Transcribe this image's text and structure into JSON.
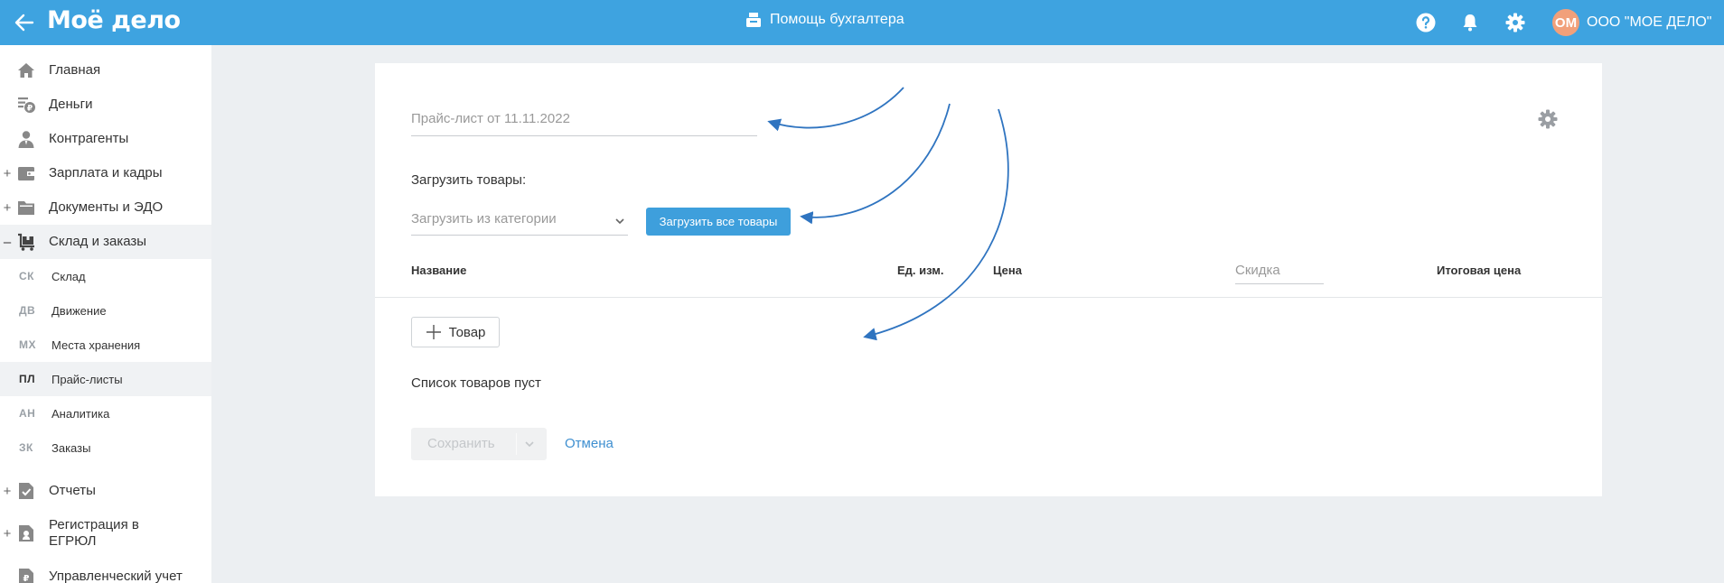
{
  "header": {
    "logo": "Моё дело",
    "help_center": "Помощь бухгалтера",
    "avatar_initials": "ОМ",
    "company": "ООО \"МОЕ ДЕЛО\""
  },
  "sidebar": {
    "items": [
      {
        "label": "Главная"
      },
      {
        "label": "Деньги"
      },
      {
        "label": "Контрагенты"
      },
      {
        "label": "Зарплата и кадры",
        "expander": "+"
      },
      {
        "label": "Документы и ЭДО",
        "expander": "+"
      },
      {
        "label": "Склад и заказы",
        "expander": "–"
      }
    ],
    "subitems": [
      {
        "abbr": "СК",
        "label": "Склад"
      },
      {
        "abbr": "ДВ",
        "label": "Движение"
      },
      {
        "abbr": "МХ",
        "label": "Места хранения"
      },
      {
        "abbr": "ПЛ",
        "label": "Прайс-листы"
      },
      {
        "abbr": "АН",
        "label": "Аналитика"
      },
      {
        "abbr": "ЗК",
        "label": "Заказы"
      }
    ],
    "bottom_items": [
      {
        "label": "Отчеты",
        "expander": "+"
      },
      {
        "label": "Регистрация в ЕГРЮЛ",
        "expander": "+"
      },
      {
        "label": "Управленческий учет"
      }
    ]
  },
  "form": {
    "title_placeholder": "Прайс-лист от 11.11.2022",
    "load_label": "Загрузить товары:",
    "category_placeholder": "Загрузить из категории",
    "load_all_button": "Загрузить все товары",
    "columns": {
      "name": "Название",
      "unit": "Ед. изм.",
      "price": "Цена",
      "discount": "Скидка",
      "total": "Итоговая цена"
    },
    "add_product_button": "Товар",
    "empty_text": "Список товаров пуст",
    "save_button": "Сохранить",
    "cancel_link": "Отмена"
  },
  "colors": {
    "topbar": "#3ea3e0",
    "primary_button": "#3e9fdc",
    "annotation_arrow": "#2f74c0"
  }
}
